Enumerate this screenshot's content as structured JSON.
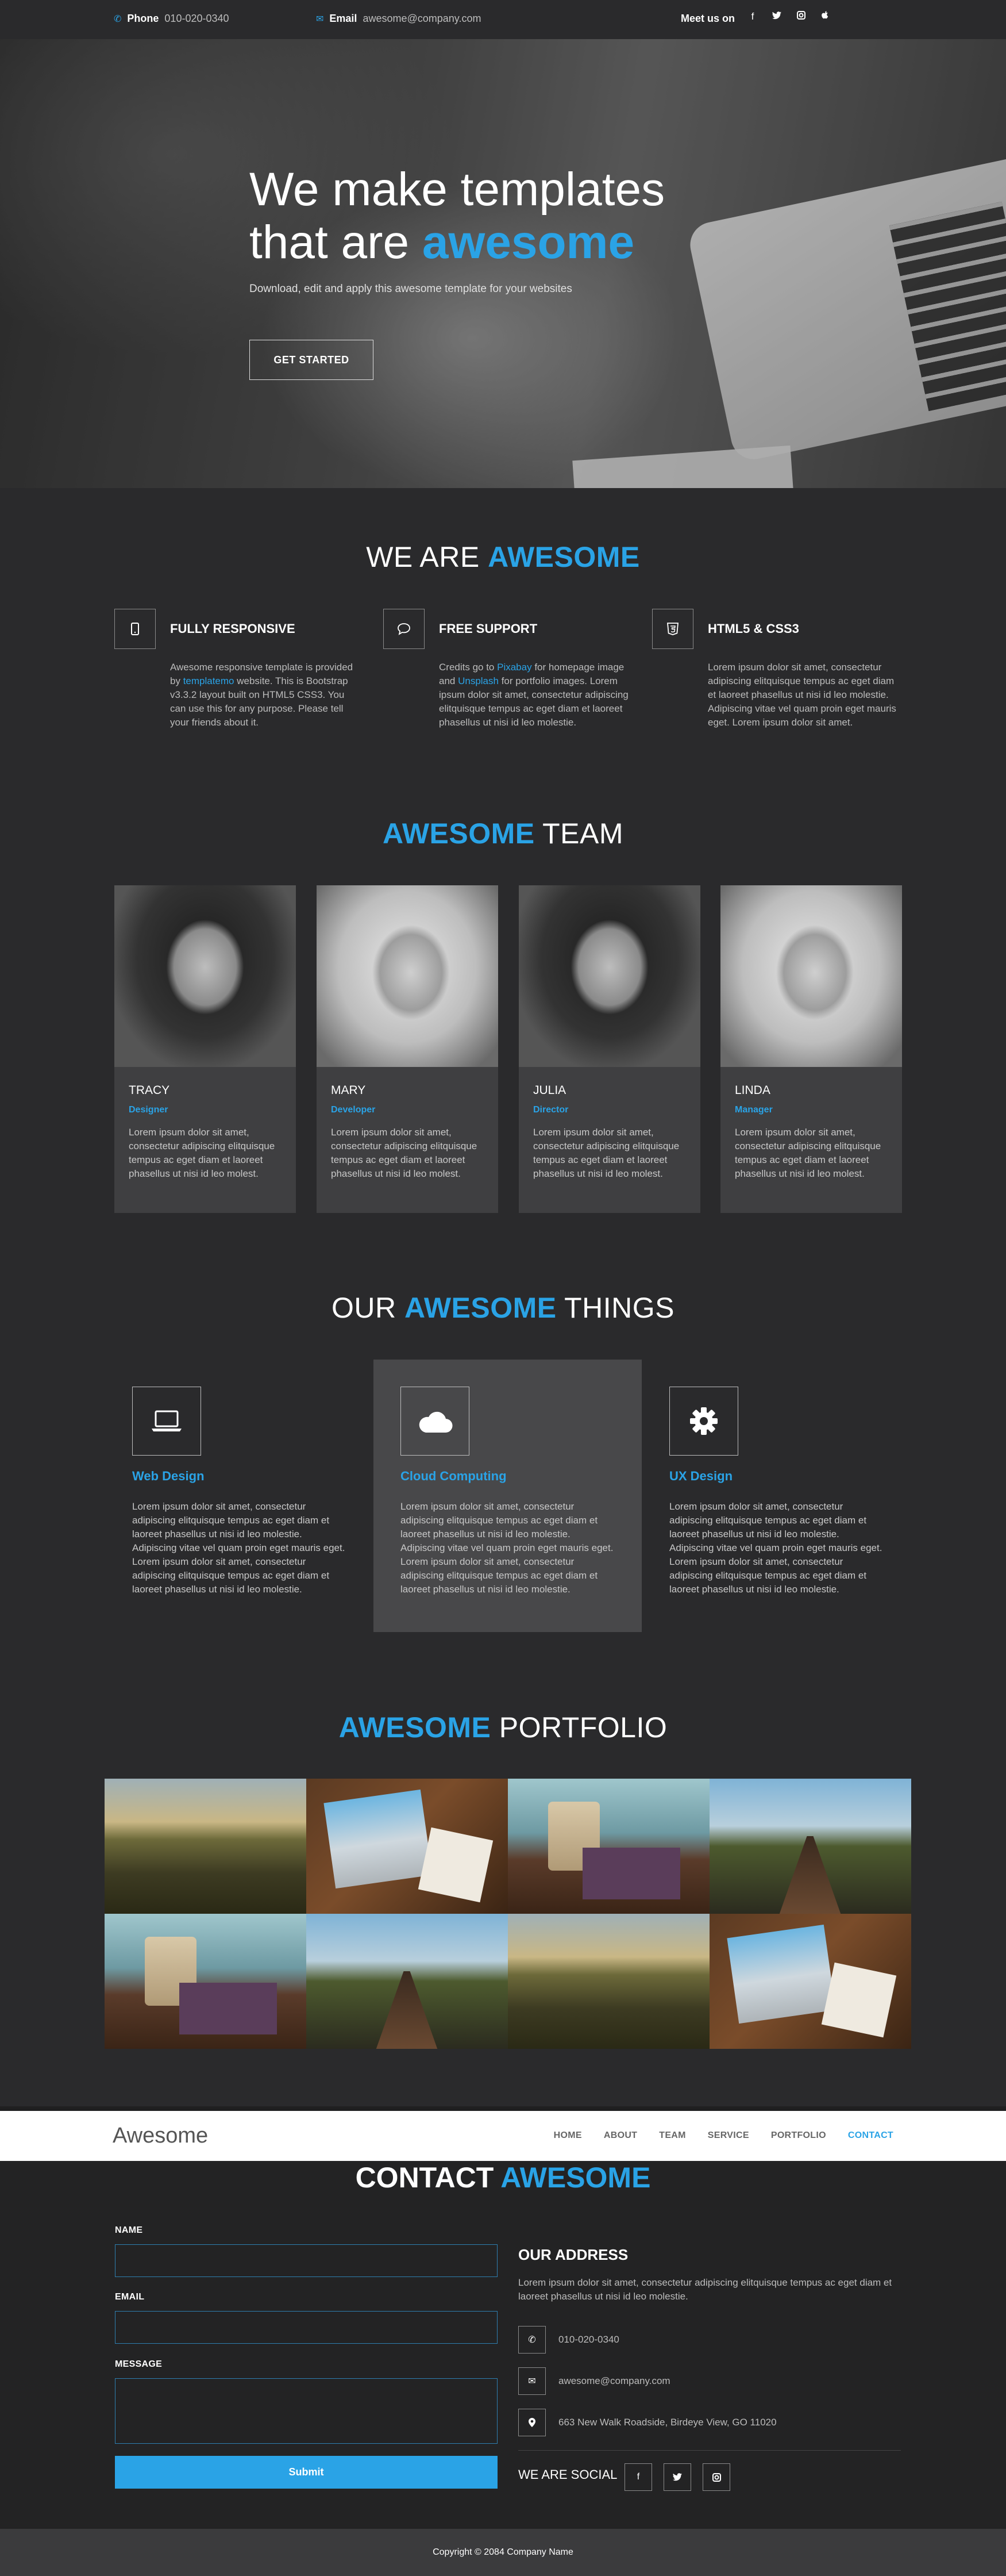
{
  "topbar": {
    "phone_label": "Phone",
    "phone": "010-020-0340",
    "email_label": "Email",
    "email": "awesome@company.com",
    "meet": "Meet us on",
    "social": [
      "f",
      "ᵥ",
      "▣",
      "●"
    ]
  },
  "hero": {
    "title_1": "We make templates",
    "title_2a": "that are ",
    "title_2b": "awesome",
    "subtitle": "Download, edit and apply this awesome template for your websites",
    "button": "GET STARTED"
  },
  "about": {
    "title_a": "WE ARE ",
    "title_b": "AWESOME",
    "features": [
      {
        "icon": "mobile-icon",
        "title": "FULLY RESPONSIVE",
        "text_a": "Awesome responsive template is provided by ",
        "link": "templatemo",
        "text_b": " website. This is Bootstrap v3.3.2 layout built on HTML5 CSS3. You can use this for any purpose. Please tell your friends about it."
      },
      {
        "icon": "chat-icon",
        "title": "FREE SUPPORT",
        "text_a": "Credits go to ",
        "link": "Pixabay",
        "text_b": " for homepage image and ",
        "link2": "Unsplash",
        "text_c": " for portfolio images. Lorem ipsum dolor sit amet, consectetur adipiscing elitquisque tempus ac eget diam et laoreet phasellus ut nisi id leo molestie."
      },
      {
        "icon": "html5-icon",
        "title": "HTML5 & CSS3",
        "text_a": "Lorem ipsum dolor sit amet, consectetur adipiscing elitquisque tempus ac eget diam et laoreet phasellus ut nisi id leo molestie. Adipiscing vitae vel quam proin eget mauris eget. Lorem ipsum dolor sit amet."
      }
    ]
  },
  "team": {
    "title_a": "AWESOME",
    "title_b": " TEAM",
    "members": [
      {
        "name": "TRACY",
        "role": "Designer",
        "bio": "Lorem ipsum dolor sit amet, consectetur adipiscing elitquisque tempus ac eget diam et laoreet phasellus ut nisi id leo molest."
      },
      {
        "name": "MARY",
        "role": "Developer",
        "bio": "Lorem ipsum dolor sit amet, consectetur adipiscing elitquisque tempus ac eget diam et laoreet phasellus ut nisi id leo molest."
      },
      {
        "name": "JULIA",
        "role": "Director",
        "bio": "Lorem ipsum dolor sit amet, consectetur adipiscing elitquisque tempus ac eget diam et laoreet phasellus ut nisi id leo molest."
      },
      {
        "name": "LINDA",
        "role": "Manager",
        "bio": "Lorem ipsum dolor sit amet, consectetur adipiscing elitquisque tempus ac eget diam et laoreet phasellus ut nisi id leo molest."
      }
    ]
  },
  "things": {
    "title_a": "OUR ",
    "title_b": "AWESOME",
    "title_c": " THINGS",
    "items": [
      {
        "icon": "laptop-icon",
        "title": "Web Design",
        "text": "Lorem ipsum dolor sit amet, consectetur adipiscing elitquisque tempus ac eget diam et laoreet phasellus ut nisi id leo molestie. Adipiscing vitae vel quam proin eget mauris eget. Lorem ipsum dolor sit amet, consectetur adipiscing elitquisque tempus ac eget diam et laoreet phasellus ut nisi id leo molestie."
      },
      {
        "icon": "cloud-icon",
        "title": "Cloud Computing",
        "text": "Lorem ipsum dolor sit amet, consectetur adipiscing elitquisque tempus ac eget diam et laoreet phasellus ut nisi id leo molestie. Adipiscing vitae vel quam proin eget mauris eget. Lorem ipsum dolor sit amet, consectetur adipiscing elitquisque tempus ac eget diam et laoreet phasellus ut nisi id leo molestie."
      },
      {
        "icon": "gear-icon",
        "title": "UX Design",
        "text": "Lorem ipsum dolor sit amet, consectetur adipiscing elitquisque tempus ac eget diam et laoreet phasellus ut nisi id leo molestie. Adipiscing vitae vel quam proin eget mauris eget. Lorem ipsum dolor sit amet, consectetur adipiscing elitquisque tempus ac eget diam et laoreet phasellus ut nisi id leo molestie."
      }
    ]
  },
  "portfolio": {
    "title_a": "AWESOME",
    "title_b": " PORTFOLIO",
    "tiles": [
      "hills",
      "laptop",
      "cup",
      "rails",
      "cup",
      "rails",
      "hills",
      "laptop"
    ]
  },
  "nav": {
    "brand": "Awesome",
    "items": [
      "HOME",
      "ABOUT",
      "TEAM",
      "SERVICE",
      "PORTFOLIO",
      "CONTACT"
    ],
    "active": "CONTACT"
  },
  "contact": {
    "title_a": "CONTACT ",
    "title_b": "AWESOME",
    "name_label": "NAME",
    "email_label": "EMAIL",
    "message_label": "MESSAGE",
    "submit": "Submit",
    "address_title": "OUR ADDRESS",
    "address_text": "Lorem ipsum dolor sit amet, consectetur adipiscing elitquisque tempus ac eget diam et laoreet phasellus ut nisi id leo molestie.",
    "phone": "010-020-0340",
    "email": "awesome@company.com",
    "address": "663 New Walk Roadside, Birdeye View, GO 11020",
    "social_title": "WE ARE SOCIAL"
  },
  "footer": {
    "copyright": "Copyright © 2084 Company Name"
  }
}
